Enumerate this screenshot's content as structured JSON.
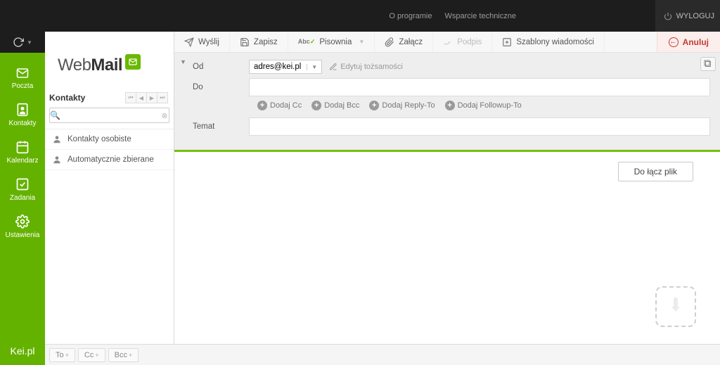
{
  "topbar": {
    "links": [
      "O programie",
      "Wsparcie techniczne"
    ],
    "logout": "WYLOGUJ"
  },
  "sidebar": {
    "items": [
      {
        "label": "Poczta"
      },
      {
        "label": "Kontakty"
      },
      {
        "label": "Kalendarz"
      },
      {
        "label": "Zadania"
      },
      {
        "label": "Ustawienia"
      }
    ],
    "footer": "Kei.pl"
  },
  "contacts": {
    "logo_a": "Web",
    "logo_b": "Mail",
    "title": "Kontakty",
    "search_placeholder": "",
    "groups": [
      "Kontakty osobiste",
      "Automatycznie zbierane"
    ]
  },
  "bottombar": {
    "chips": [
      "To",
      "Cc",
      "Bcc"
    ]
  },
  "toolbar": {
    "send": "Wyślij",
    "save": "Zapisz",
    "spell": "Pisownia",
    "attach": "Załącz",
    "sign": "Podpis",
    "templates": "Szablony wiadomości",
    "cancel": "Anuluj"
  },
  "fields": {
    "from_label": "Od",
    "from_value": "adres@kei.pl",
    "edit_identities": "Edytuj tożsamości",
    "to_label": "Do",
    "subject_label": "Temat",
    "add": {
      "cc": "Dodaj Cc",
      "bcc": "Dodaj Bcc",
      "reply": "Dodaj Reply-To",
      "follow": "Dodaj Followup-To"
    }
  },
  "body": {
    "attach_btn": "Do łącz plik"
  }
}
